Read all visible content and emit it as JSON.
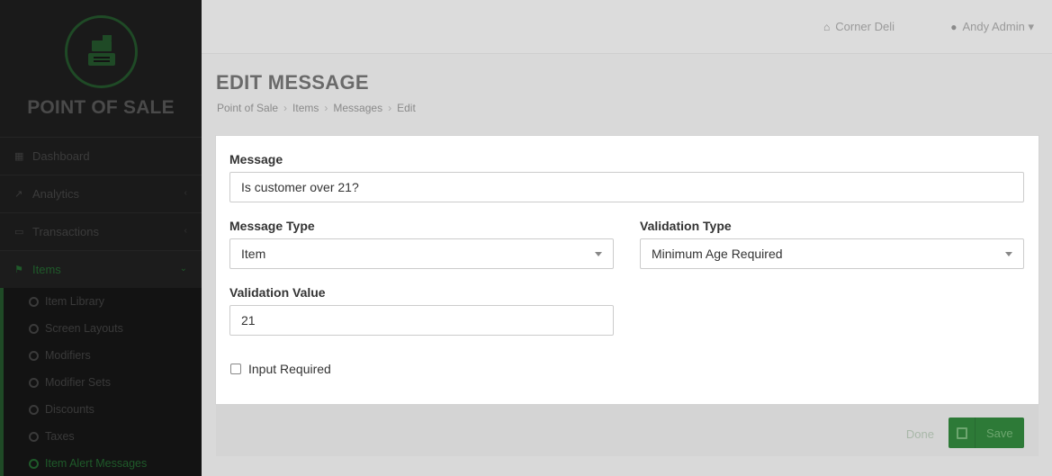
{
  "app": {
    "name": "POINT OF SALE",
    "accent_color": "#2d7a37"
  },
  "topbar": {
    "store_icon": "home-icon",
    "store_name": "Corner Deli",
    "user_icon": "user-icon",
    "user_name": "Andy Admin ▾"
  },
  "sidebar": {
    "items": [
      {
        "label": "Dashboard",
        "icon": "grid-icon"
      },
      {
        "label": "Analytics",
        "icon": "chart-icon"
      },
      {
        "label": "Transactions",
        "icon": "money-icon"
      },
      {
        "label": "Items",
        "icon": "tag-icon"
      }
    ],
    "sub_items": [
      {
        "label": "Item Library"
      },
      {
        "label": "Screen Layouts"
      },
      {
        "label": "Modifiers"
      },
      {
        "label": "Modifier Sets"
      },
      {
        "label": "Discounts"
      },
      {
        "label": "Taxes"
      },
      {
        "label": "Item Alert Messages"
      }
    ]
  },
  "page": {
    "title": "EDIT MESSAGE",
    "breadcrumb": [
      "Point of Sale",
      "Items",
      "Messages",
      "Edit"
    ]
  },
  "form": {
    "message_label": "Message",
    "message_value": "Is customer over 21?",
    "message_type_label": "Message Type",
    "message_type_value": "Item",
    "validation_type_label": "Validation Type",
    "validation_type_value": "Minimum Age Required",
    "validation_value_label": "Validation Value",
    "validation_value": "21",
    "input_required_label": "Input Required"
  },
  "footer": {
    "done_label": "Done",
    "save_label": "Save"
  }
}
